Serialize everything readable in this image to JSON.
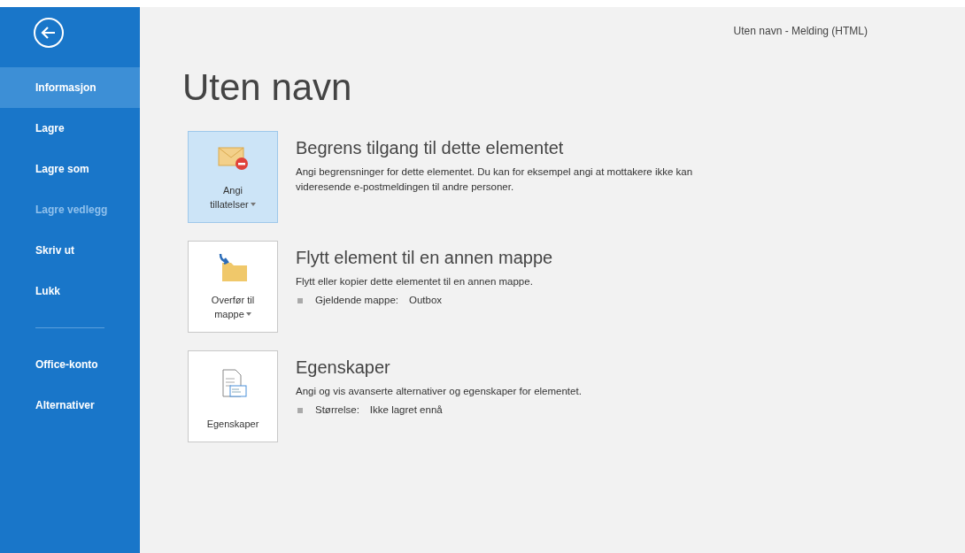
{
  "window": {
    "title": "Uten navn - Melding (HTML)"
  },
  "sidebar": {
    "items": [
      {
        "label": "Informasjon",
        "selected": true,
        "disabled": false
      },
      {
        "label": "Lagre",
        "selected": false,
        "disabled": false
      },
      {
        "label": "Lagre som",
        "selected": false,
        "disabled": false
      },
      {
        "label": "Lagre vedlegg",
        "selected": false,
        "disabled": true
      },
      {
        "label": "Skriv ut",
        "selected": false,
        "disabled": false
      },
      {
        "label": "Lukk",
        "selected": false,
        "disabled": false
      },
      {
        "kind": "separator"
      },
      {
        "label": "Office-konto",
        "selected": false,
        "disabled": false
      },
      {
        "label": "Alternativer",
        "selected": false,
        "disabled": false
      }
    ]
  },
  "heading": "Uten navn",
  "sections": [
    {
      "kind": "restricted",
      "button": {
        "lines": [
          "Angi",
          "tillatelser"
        ],
        "dropdown": true,
        "selected": true
      },
      "title": "Begrens tilgang til dette elementet",
      "description": "Angi begrensninger for dette elementet. Du kan for eksempel angi at mottakere ikke kan videresende e-postmeldingen til andre personer."
    },
    {
      "kind": "move",
      "button": {
        "lines": [
          "Overfør til",
          "mappe"
        ],
        "dropdown": true,
        "selected": false
      },
      "title": "Flytt element til en annen mappe",
      "description": "Flytt eller kopier dette elementet til en annen mappe.",
      "details": [
        {
          "label": "Gjeldende mappe:",
          "value": "Outbox"
        }
      ]
    },
    {
      "kind": "properties",
      "button": {
        "lines": [
          "Egenskaper"
        ],
        "dropdown": false,
        "selected": false
      },
      "title": "Egenskaper",
      "description": "Angi og vis avanserte alternativer og egenskaper for elementet.",
      "details": [
        {
          "label": "Størrelse:",
          "value": "Ikke lagret ennå"
        }
      ]
    }
  ]
}
